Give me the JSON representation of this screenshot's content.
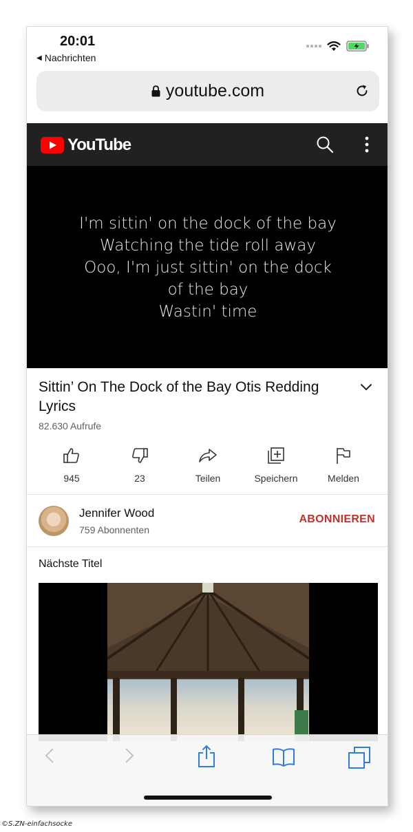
{
  "status": {
    "time": "20:01",
    "back_app": "Nachrichten"
  },
  "browser": {
    "url": "youtube.com"
  },
  "youtube": {
    "brand": "YouTube",
    "video_lyrics": [
      "I'm sittin' on the dock of the bay",
      "Watching the tide roll away",
      "Ooo, I'm just sittin' on the dock",
      "of the bay",
      "Wastin' time"
    ],
    "title_line1": "Sittin’ On The Dock of the Bay Otis Redding",
    "title_line2": "Lyrics",
    "views": "82.630 Aufrufe",
    "actions": {
      "like": "945",
      "dislike": "23",
      "share": "Teilen",
      "save": "Speichern",
      "report": "Melden"
    },
    "channel": {
      "name": "Jennifer Wood",
      "subscribers": "759 Abonnenten",
      "subscribe_label": "ABONNIEREN"
    },
    "next_heading": "Nächste Titel"
  },
  "watermark": "©S.ZN-einfachsocke",
  "colors": {
    "youtube_red": "#ff0000",
    "subscribe_red": "#c4302b",
    "ios_blue": "#2f7de1"
  }
}
